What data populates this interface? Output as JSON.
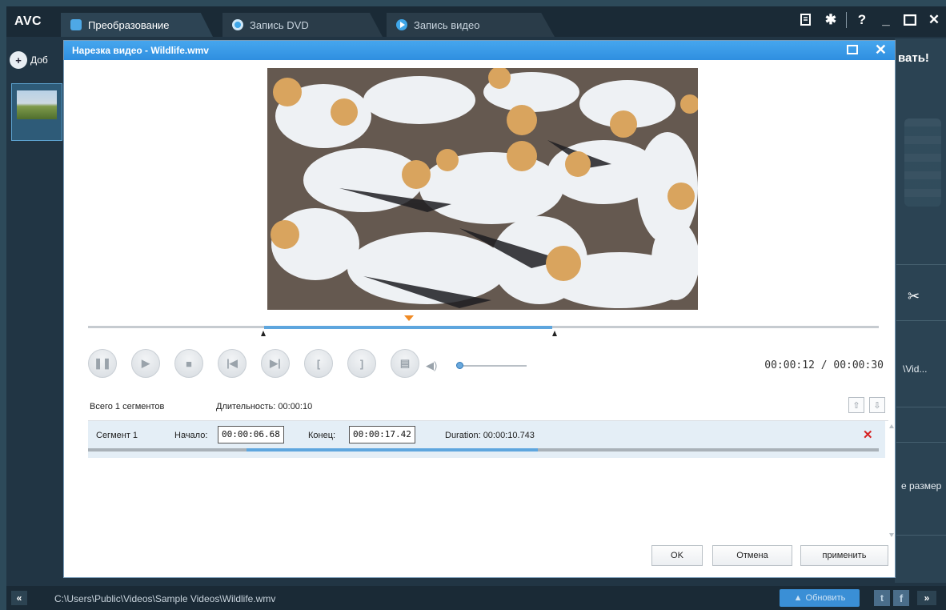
{
  "app": {
    "logo": "AVC",
    "tabs": [
      {
        "label": "Преобразование"
      },
      {
        "label": "Запись DVD"
      },
      {
        "label": "Запись видео"
      }
    ],
    "add_label": "Доб",
    "convert_label": "вать!",
    "path_fragment": "\\Vid... ",
    "size_fragment": "е размер"
  },
  "status": {
    "path": "C:\\Users\\Public\\Videos\\Sample Videos\\Wildlife.wmv",
    "update_label": "Обновить",
    "twitter_glyph": "t",
    "facebook_glyph": "f"
  },
  "dialog": {
    "title": "Нарезка видео - Wildlife.wmv",
    "time": "00:00:12 / 00:00:30",
    "segments_total": "Всего 1 сегментов",
    "total_duration": "Длительность: 00:00:10",
    "segment": {
      "name": "Сегмент 1",
      "start_label": "Начало:",
      "start": "00:00:06.68",
      "end_label": "Конец:",
      "end": "00:00:17.42",
      "duration": "Duration: 00:00:10.743"
    },
    "buttons": {
      "ok": "OK",
      "cancel": "Отмена",
      "apply": "применить"
    }
  },
  "colors": {
    "title_bar": "#2f8fe0",
    "selection": "#5ea6de",
    "playhead": "#f08a24",
    "delete": "#d62222"
  }
}
